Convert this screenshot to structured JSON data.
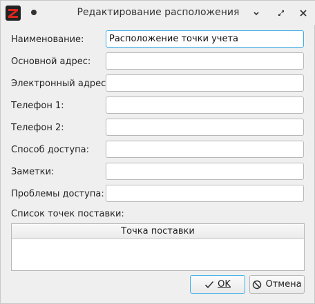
{
  "window": {
    "title": "Редактирование расположения"
  },
  "form": {
    "fields": [
      {
        "label": "Наименование:",
        "value": "Расположение точки учета"
      },
      {
        "label": "Основной адрес:",
        "value": ""
      },
      {
        "label": "Электронный адрес:",
        "value": ""
      },
      {
        "label": "Телефон 1:",
        "value": ""
      },
      {
        "label": "Телефон 2:",
        "value": ""
      },
      {
        "label": "Способ доступа:",
        "value": ""
      },
      {
        "label": "Заметки:",
        "value": ""
      },
      {
        "label": "Проблемы доступа:",
        "value": ""
      }
    ],
    "delivery_points_label": "Список точек поставки:",
    "table_header": "Точка поставки"
  },
  "buttons": {
    "ok_label": "OK",
    "cancel_label": "Отмена"
  },
  "colors": {
    "focus": "#3daee9",
    "logo_red": "#d9261c"
  },
  "icons": [
    "app-logo-icon",
    "pin-icon",
    "minimize-icon",
    "restore-icon",
    "close-icon",
    "checkmark-icon",
    "cancel-icon"
  ]
}
